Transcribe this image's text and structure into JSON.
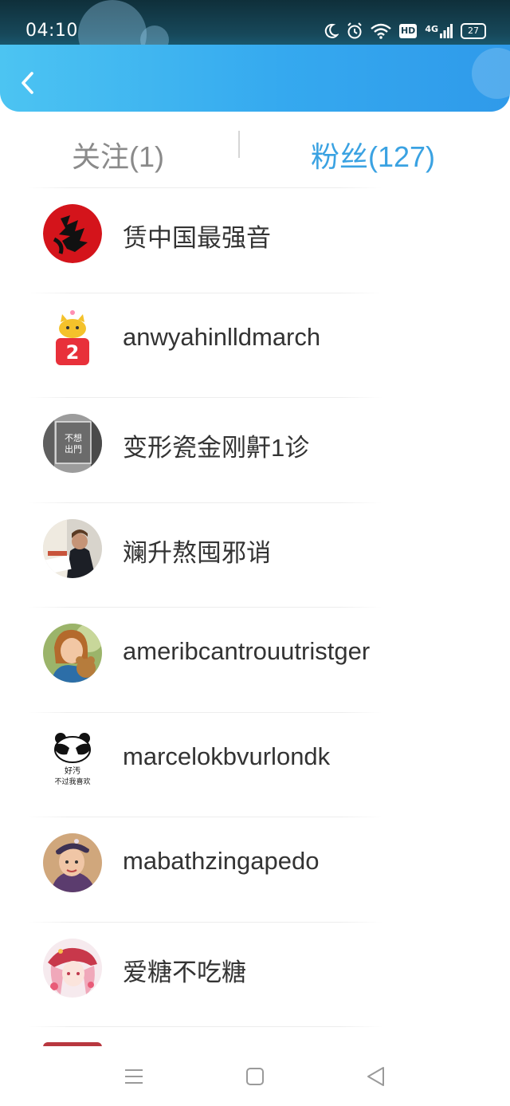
{
  "status_bar": {
    "time": "04:10",
    "battery": "27",
    "network": "4G",
    "hd": "HD"
  },
  "header": {
    "back_icon": "chevron-left-icon"
  },
  "tabs": [
    {
      "label": "关注(1)",
      "active": false
    },
    {
      "label": "粉丝(127)",
      "active": true
    }
  ],
  "colors": {
    "accent": "#3aa2e2",
    "inactive_tab": "#8a8a8a",
    "header_start": "#4cc4f2",
    "header_end": "#2f9aea",
    "name_text": "#333333"
  },
  "fans": [
    {
      "name": "赁中国最强音",
      "avatar": "fu-character-avatar"
    },
    {
      "name": "anwyahinlldmarch",
      "avatar": "cartoon-cat-number-2-avatar"
    },
    {
      "name": "变形瓷金刚鼾1诊",
      "avatar": "text-sign-avatar"
    },
    {
      "name": "斓升熬囤邪诮",
      "avatar": "man-at-desk-avatar"
    },
    {
      "name": "ameribcantrouutristger",
      "avatar": "girl-with-teddy-bear-avatar"
    },
    {
      "name": "marcelokbvurlondk",
      "avatar": "panda-meme-avatar"
    },
    {
      "name": "mabathzingapedo",
      "avatar": "person-with-hat-avatar"
    },
    {
      "name": "爱糖不吃糖",
      "avatar": "anime-girl-avatar"
    }
  ],
  "avatar_text": {
    "row2_badge": "2",
    "row3_sign": "不想 出門",
    "row6_caption_top": "好汚",
    "row6_caption_bottom": "不过我喜欢"
  },
  "nav_bar": {
    "icons": [
      "menu-icon",
      "home-square-icon",
      "back-triangle-icon"
    ]
  }
}
